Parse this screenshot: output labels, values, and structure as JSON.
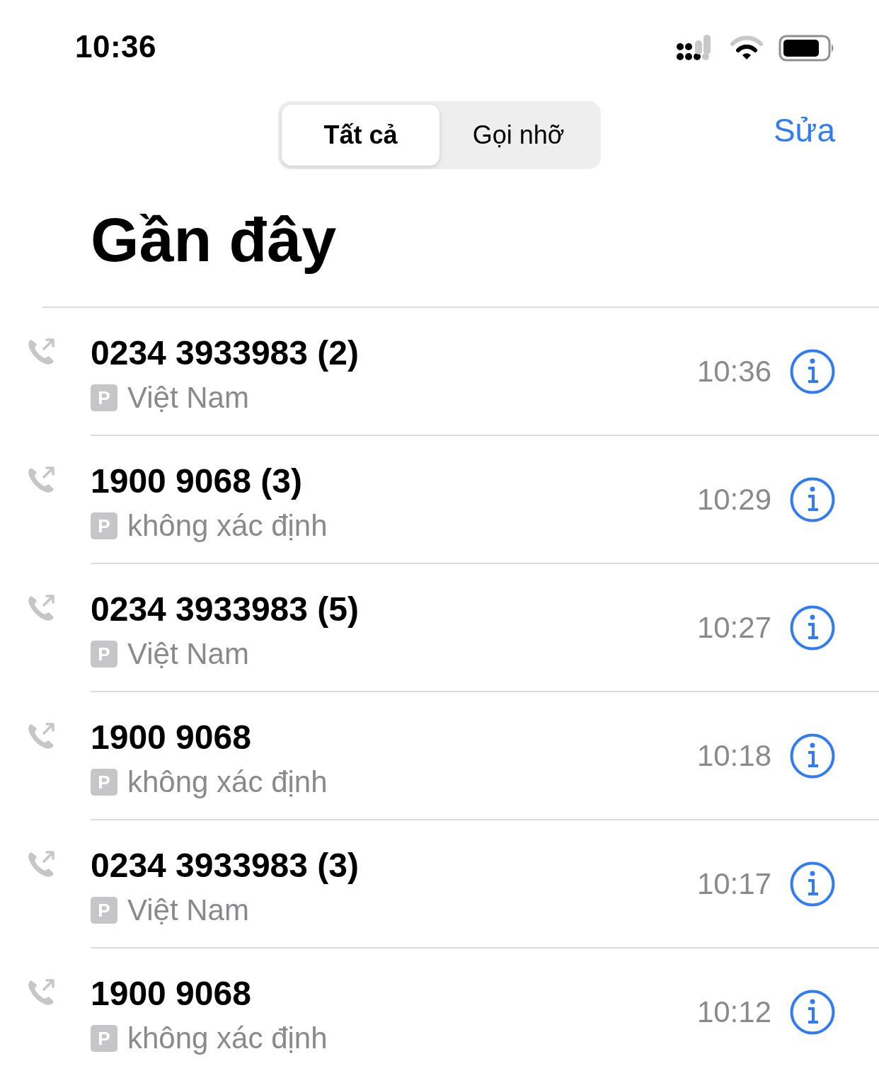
{
  "status_bar": {
    "time": "10:36"
  },
  "segments": [
    {
      "label": "Tất cả",
      "selected": true
    },
    {
      "label": "Gọi nhỡ",
      "selected": false
    }
  ],
  "edit_button": "Sửa",
  "title": "Gần đây",
  "calls": [
    {
      "number": "0234 3933983 (2)",
      "badge": "P",
      "label": "Việt Nam",
      "time": "10:36"
    },
    {
      "number": "1900 9068 (3)",
      "badge": "P",
      "label": "không xác định",
      "time": "10:29"
    },
    {
      "number": "0234 3933983 (5)",
      "badge": "P",
      "label": "Việt Nam",
      "time": "10:27"
    },
    {
      "number": "1900 9068",
      "badge": "P",
      "label": "không xác định",
      "time": "10:18"
    },
    {
      "number": "0234 3933983 (3)",
      "badge": "P",
      "label": "Việt Nam",
      "time": "10:17"
    },
    {
      "number": "1900 9068",
      "badge": "P",
      "label": "không xác định",
      "time": "10:12"
    }
  ]
}
